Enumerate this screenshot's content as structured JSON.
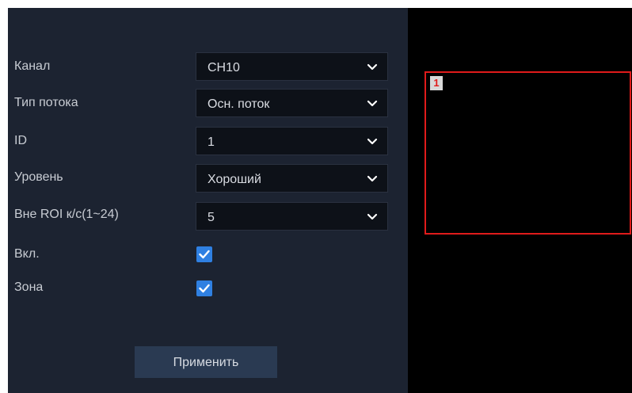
{
  "form": {
    "channel": {
      "label": "Канал",
      "value": "CH10"
    },
    "stream_type": {
      "label": "Тип потока",
      "value": "Осн. поток"
    },
    "id": {
      "label": "ID",
      "value": "1"
    },
    "level": {
      "label": "Уровень",
      "value": "Хороший"
    },
    "non_roi_fps": {
      "label": "Вне ROI к/с(1~24)",
      "value": "5"
    },
    "enable": {
      "label": "Вкл.",
      "checked": true
    },
    "zone": {
      "label": "Зона",
      "checked": true
    },
    "apply_label": "Применить"
  },
  "preview": {
    "region_number": "1"
  },
  "colors": {
    "panel_bg": "#1c2331",
    "field_bg": "#0d1118",
    "checkbox": "#2f80e2",
    "button_bg": "#2a3a52",
    "roi_border": "#e01b1b",
    "preview_bg": "#000000"
  },
  "icons": {
    "dropdown": "chevron-down-icon",
    "check": "checkmark-icon"
  }
}
